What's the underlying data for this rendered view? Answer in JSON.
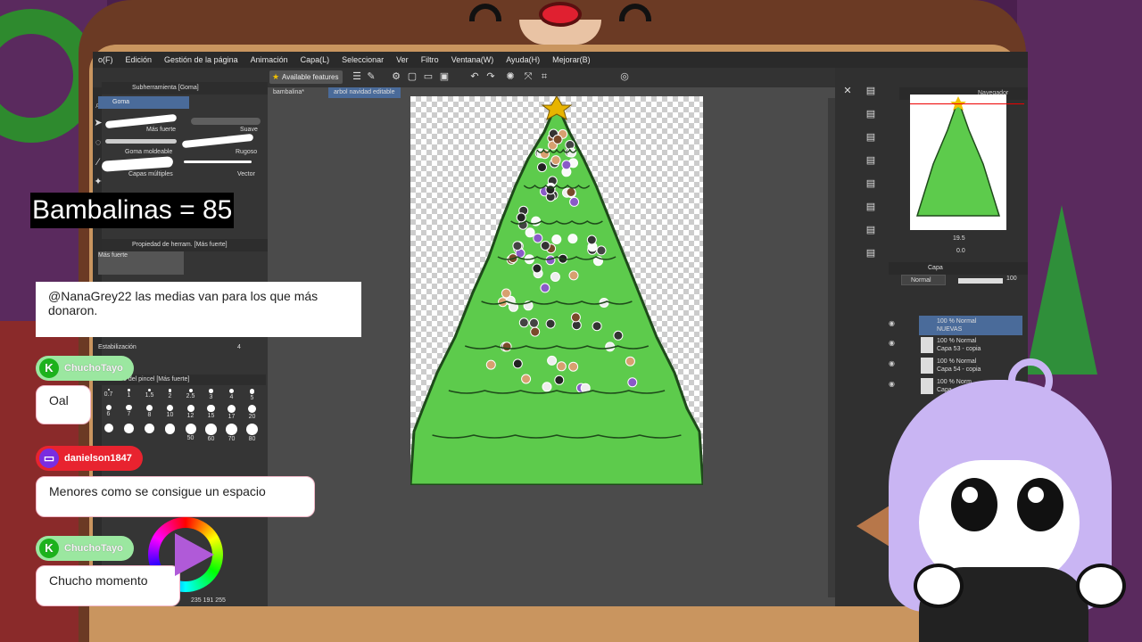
{
  "menu": [
    "o(F)",
    "Edición",
    "Gestión de la página",
    "Animación",
    "Capa(L)",
    "Seleccionar",
    "Ver",
    "Filtro",
    "Ventana(W)",
    "Ayuda(H)",
    "Mejorar(B)"
  ],
  "toolbar": {
    "features_label": "Available features"
  },
  "subtool": {
    "panel_title": "Subherramienta [Goma]",
    "tab_label": "Goma",
    "brushes": [
      "Más fuerte",
      "Suave",
      "Goma moldeable",
      "Rugoso",
      "Capas múltiples",
      "Vector"
    ]
  },
  "tool_property": {
    "panel_title": "Propiedad de herram. [Más fuerte]",
    "preview_label": "Más fuerte",
    "stabilization_label": "Estabilización",
    "stabilization_value": "4"
  },
  "brush_size": {
    "panel_title": "o del pincel [Más fuerte]",
    "sizes": [
      "0.7",
      "1",
      "1.5",
      "2",
      "2.5",
      "3",
      "4",
      "5",
      "6",
      "7",
      "8",
      "10",
      "12",
      "15",
      "17",
      "20",
      "",
      "",
      "",
      "",
      "50",
      "60",
      "70",
      "80",
      "100"
    ]
  },
  "color": {
    "readout": "235 191 255"
  },
  "canvas": {
    "tabs": [
      "bambalina*",
      "arbol navidad editable"
    ]
  },
  "navigator": {
    "title": "Navegador",
    "zoom": "19.5",
    "rotation": "0.0"
  },
  "layers": {
    "panel_title": "Capa",
    "blend_mode": "Normal",
    "opacity": "100",
    "items": [
      {
        "mode": "100 % Normal",
        "name": "NUEVAS"
      },
      {
        "mode": "100 % Normal",
        "name": "Capa 53 - copia"
      },
      {
        "mode": "100 % Normal",
        "name": "Capa 54 - copia"
      },
      {
        "mode": "100 % Norm",
        "name": "Capa"
      }
    ]
  },
  "overlay": {
    "counter": "Bambalinas = 85",
    "chat": [
      {
        "user": "",
        "platform": "",
        "message": "@NanaGrey22 las medias van para los que más donaron."
      },
      {
        "user": "ChuchoTayo",
        "platform": "kick",
        "message": "Oal"
      },
      {
        "user": "danielson1847",
        "platform": "twitch",
        "message": "Menores como se consigue un espacio"
      },
      {
        "user": "ChuchoTayo",
        "platform": "kick",
        "message": "Chucho momento"
      }
    ]
  },
  "colors": {
    "tree_green": "#5dcb4c",
    "tree_outline": "#1e4a1a",
    "active_tab": "#4a6b9a",
    "nose_red": "#e02030",
    "hair": "#c9b5f3"
  },
  "icons": {
    "kick": "K",
    "twitch": "twitch-glyph"
  }
}
